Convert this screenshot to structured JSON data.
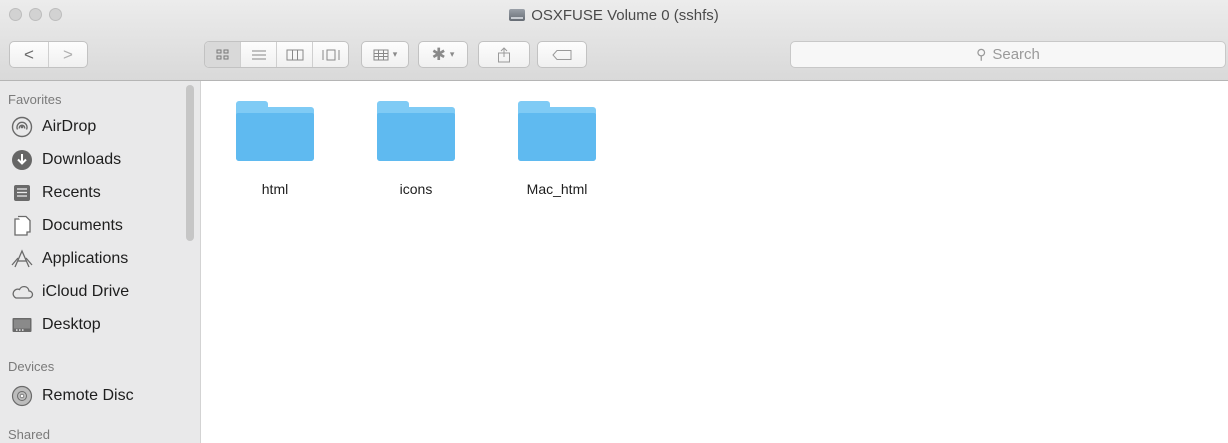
{
  "window": {
    "title": "OSXFUSE Volume 0 (sshfs)"
  },
  "toolbar": {
    "back_label": "<",
    "forward_label": ">",
    "search_placeholder": "Search"
  },
  "sidebar": {
    "favorites_header": "Favorites",
    "favorites": [
      {
        "label": "AirDrop",
        "icon": "airdrop-icon"
      },
      {
        "label": "Downloads",
        "icon": "downloads-icon"
      },
      {
        "label": "Recents",
        "icon": "recents-icon"
      },
      {
        "label": "Documents",
        "icon": "documents-icon"
      },
      {
        "label": "Applications",
        "icon": "applications-icon"
      },
      {
        "label": "iCloud Drive",
        "icon": "icloud-icon"
      },
      {
        "label": "Desktop",
        "icon": "desktop-icon"
      }
    ],
    "devices_header": "Devices",
    "devices": [
      {
        "label": "Remote Disc",
        "icon": "remote-disc-icon"
      }
    ],
    "shared_header": "Shared"
  },
  "files": [
    {
      "name": "html",
      "icon": "folder-icon"
    },
    {
      "name": "icons",
      "icon": "folder-icon"
    },
    {
      "name": "Mac_html",
      "icon": "folder-icon"
    }
  ],
  "colors": {
    "folder_front": "#5fbaf0",
    "folder_back": "#7fcbf5",
    "sidebar_bg": "#e9e9ea"
  }
}
